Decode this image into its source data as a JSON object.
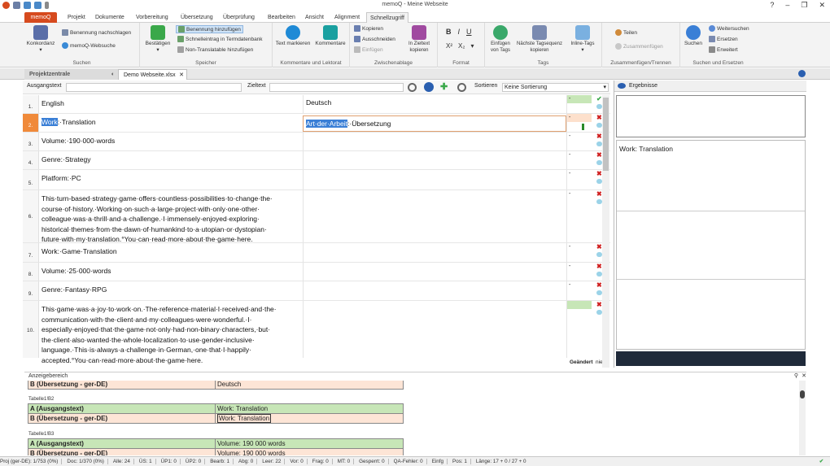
{
  "window": {
    "title": "memoQ - Meine Webseite"
  },
  "tabs": [
    "memoQ",
    "Projekt",
    "Dokumente",
    "Vorbereitung",
    "Übersetzung",
    "Überprüfung",
    "Bearbeiten",
    "Ansicht",
    "Alignment",
    "Schnellzugriff"
  ],
  "ribbon": {
    "konkordanz": "Konkordanz",
    "benennung_nach": "Benennung nachschlagen",
    "websuche": "memoQ-Websuche",
    "suchen_group": "Suchen",
    "bestaetigen": "Bestätigen",
    "benennung_hinzu": "Benennung hinzufügen",
    "schnelleintrag": "Schnelleintrag in Termdatenbank",
    "non_translatable": "Non-Translatable hinzufügen",
    "speicher_group": "Speicher",
    "text_markieren": "Text markieren",
    "kommentare": "Kommentare",
    "kommentare_group": "Kommentare und Lektorat",
    "kopieren": "Kopieren",
    "ausschneiden": "Ausschneiden",
    "einfuegen": "Einfügen",
    "in_zieltext": "In Zieltext kopieren",
    "zwischenablage_group": "Zwischenablage",
    "format_group": "Format",
    "einfuegen_tags": "Einfügen von Tags",
    "naechste_tag": "Nächste Tagsequenz kopieren",
    "inline_tags": "Inline-Tags",
    "tags_group": "Tags",
    "teilen": "Teilen",
    "zusammenfuegen": "Zusammenfügen",
    "zusammen_group": "Zusammenfügen/Trennen",
    "suchen": "Suchen",
    "weitersuchen": "Weitersuchen",
    "ersetzen": "Ersetzen",
    "erweitert": "Erweitert",
    "suchen_ersetzen_group": "Suchen und Ersetzen"
  },
  "doctabs": {
    "projektzentrale": "Projektzentrale",
    "doc": "Demo Webseite.xlsx"
  },
  "filter": {
    "ausgangstext": "Ausgangstext",
    "zieltext": "Zieltext",
    "sortieren": "Sortieren",
    "sort_value": "Keine Sortierung"
  },
  "rows": [
    {
      "n": "1.",
      "src": "English",
      "tgt": "Deutsch",
      "pct": "-",
      "mark": "check"
    },
    {
      "n": "2.",
      "src": "Work:·Translation",
      "tgt": "Art·der·Arbeit:·Übersetzung",
      "pct": "-",
      "mark": "x"
    },
    {
      "n": "3.",
      "src": "Volume:·190·000·words",
      "tgt": "",
      "pct": "-",
      "mark": "x"
    },
    {
      "n": "4.",
      "src": "Genre:·Strategy",
      "tgt": "",
      "pct": "-",
      "mark": "x"
    },
    {
      "n": "5.",
      "src": "Platform:·PC",
      "tgt": "",
      "pct": "-",
      "mark": "x"
    },
    {
      "n": "6.",
      "src": "This·turn-based·strategy·game·offers·countless·possibilities·to·change·the·\ncourse·of·history.·Working·on·such·a·large·project·with·only·one·other·\ncolleague·was·a·thrill·and·a·challenge.·I·immensely·enjoyed·exploring·\nhistorical·themes·from·the·dawn·of·humankind·to·a·utopian·or·dystopian·\nfuture·with·my·translation.°You·can·read·more·about·the·game·here.",
      "tgt": "",
      "pct": "-",
      "mark": "x"
    },
    {
      "n": "7.",
      "src": "Work:·Game·Translation",
      "tgt": "",
      "pct": "-",
      "mark": "x"
    },
    {
      "n": "8.",
      "src": "Volume:·25·000·words",
      "tgt": "",
      "pct": "-",
      "mark": "x"
    },
    {
      "n": "9.",
      "src": "Genre:·Fantasy·RPG",
      "tgt": "",
      "pct": "-",
      "mark": "x"
    },
    {
      "n": "10.",
      "src": "This·game·was·a·joy·to·work·on.·The·reference·material·I·received·and·the·\ncommunication·with·the·client·and·my·colleagues·were·wonderful.·I·\nespecially·enjoyed·that·the·game·not·only·had·non-binary·characters,·but·\nthe·client·also·wanted·the·whole·localization·to·use·gender-inclusive·\nlanguage.·This·is·always·a·challenge·in·German,·one·that·I·happily·\naccepted.°You·can·read·more·about·the·game·here.",
      "tgt": "",
      "pct": "",
      "mark": ""
    }
  ],
  "seg2": {
    "src_hl": "Work",
    "src_rest": ":·Translation",
    "tgt_hl": "Art·der·Arbeit",
    "tgt_rest": ":·Übersetzung"
  },
  "right": {
    "title": "Ergebnisse",
    "match": "Work: Translation"
  },
  "geaendert": "Geändert",
  "nie": "nie",
  "view": {
    "title": "Anzeigebereich",
    "t0_b_label": "B (Übersetzung - ger-DE)",
    "t0_b_val": "Deutsch",
    "t1_cap": "Tabelle1!B2",
    "t1_a_label": "A (Ausgangstext)",
    "t1_a_val": "Work: Translation",
    "t1_b_label": "B (Übersetzung - ger-DE)",
    "t1_b_val": "Work: Translation",
    "t2_cap": "Tabelle1!B3",
    "t2_a_label": "A (Ausgangstext)",
    "t2_a_val": "Volume: 190 000 words",
    "t2_b_label": "B (Übersetzung - ger-DE)",
    "t2_b_val": "Volume: 190 000 words"
  },
  "status": [
    "Proj (ger-DE): 1/753 (0%)",
    "Doc: 1/370 (0%)",
    "Alle: 24",
    "ÜS: 1",
    "ÜP1: 0",
    "ÜP2: 0",
    "Bearb: 1",
    "Abg: 0",
    "Leer: 22",
    "Vor: 0",
    "Frag: 0",
    "MT: 0",
    "Gesperrt: 0",
    "QA-Fehler: 0",
    "Einfg",
    "Pos: 1",
    "Länge: 17 + 0 / 27 + 0"
  ]
}
